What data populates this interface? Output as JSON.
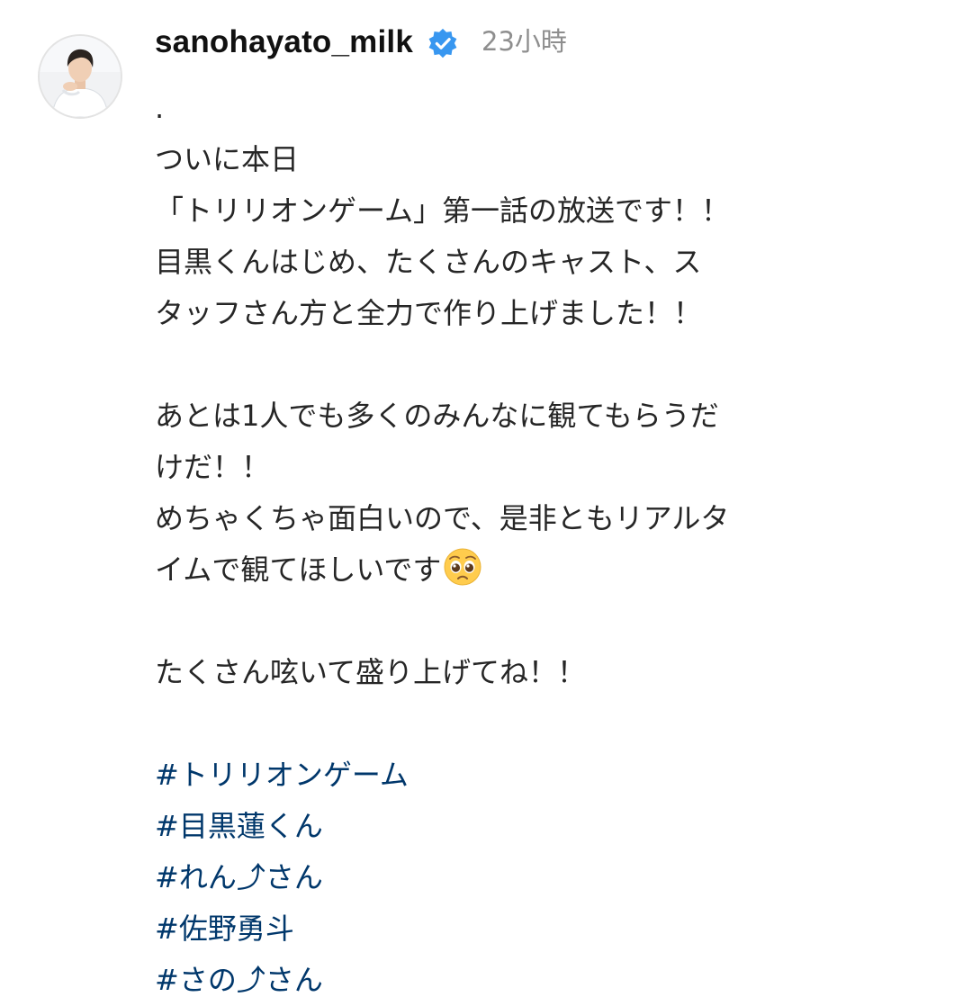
{
  "post": {
    "username": "sanohayato_milk",
    "verified_icon": "verified-badge-icon",
    "timestamp": "23小時",
    "avatar_icon": "profile-avatar",
    "colors": {
      "username": "#111111",
      "text": "#262626",
      "timestamp": "#8e8e8e",
      "hashtag": "#00376b",
      "verified_badge": "#3897f0"
    }
  },
  "caption": {
    "dot": ".",
    "lines": [
      "ついに本日",
      "「トリリオンゲーム」第一話の放送です！！",
      "目黒くんはじめ、たくさんのキャスト、ス",
      "タッフさん方と全力で作り上げました！！",
      "あとは1人でも多くのみんなに観てもらうだ",
      "けだ！！",
      "めちゃくちゃ面白いので、是非ともリアルタ",
      "イムで観てほしいです",
      "たくさん呟いて盛り上げてね！！"
    ],
    "emoji": "pleading-face-emoji"
  },
  "hashtags": [
    "#トリリオンゲーム",
    "#目黒蓮くん",
    "#れん⤴︎さん",
    "#佐野勇斗",
    "#さの⤴︎さん"
  ]
}
